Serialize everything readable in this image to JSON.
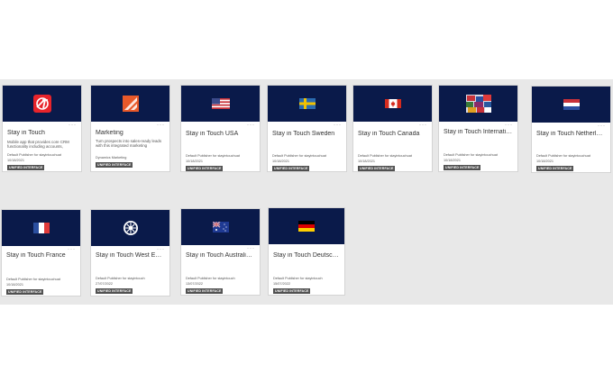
{
  "badge": "UNIFIED INTERFACE",
  "more_icon": "ellipsis-icon",
  "cards": [
    {
      "title": "Stay in Touch",
      "description": "Mobile app that provides core CRM functionality including accounts,",
      "publisher": "Default Publisher for stayintouchuat",
      "date": "10/18/2021",
      "icon": "stay-in-touch-logo"
    },
    {
      "title": "Marketing",
      "description": "Turn prospects into sales-ready leads with this integrated marketing",
      "publisher": "Dynamics Marketing",
      "date": "",
      "icon": "marketing-logo"
    },
    {
      "title": "Stay in Touch USA",
      "description": "",
      "publisher": "Default Publisher for stayintouchuat",
      "date": "10/18/2021",
      "icon": "usa-flag"
    },
    {
      "title": "Stay in Touch Sweden",
      "description": "",
      "publisher": "Default Publisher for stayintouchuat",
      "date": "10/18/2021",
      "icon": "sweden-flag"
    },
    {
      "title": "Stay in Touch Canada",
      "description": "",
      "publisher": "Default Publisher for stayintouchuat",
      "date": "10/18/2021",
      "icon": "canada-flag"
    },
    {
      "title": "Stay in Touch International",
      "description": "",
      "publisher": "Default Publisher for stayintouchuat",
      "date": "10/18/2021",
      "icon": "international-flags"
    },
    {
      "title": "Stay in Touch Netherlands",
      "description": "",
      "publisher": "Default Publisher for stayintouchuat",
      "date": "10/18/2021",
      "icon": "netherlands-flag"
    },
    {
      "title": "Stay in Touch France",
      "description": "",
      "publisher": "Default Publisher for stayintouchuat",
      "date": "10/18/2021",
      "icon": "france-flag"
    },
    {
      "title": "Stay in Touch West Europe",
      "description": "",
      "publisher": "Default Publisher for stayintouch",
      "date": "27/07/2022",
      "icon": "west-europe-logo"
    },
    {
      "title": "Stay in Touch Australia / New Zealand",
      "description": "",
      "publisher": "Default Publisher for stayintouch",
      "date": "13/07/2022",
      "icon": "australia-flag"
    },
    {
      "title": "Stay in Touch Deutschland",
      "description": "",
      "publisher": "Default Publisher for stayintouch",
      "date": "15/07/2022",
      "icon": "germany-flag"
    }
  ]
}
